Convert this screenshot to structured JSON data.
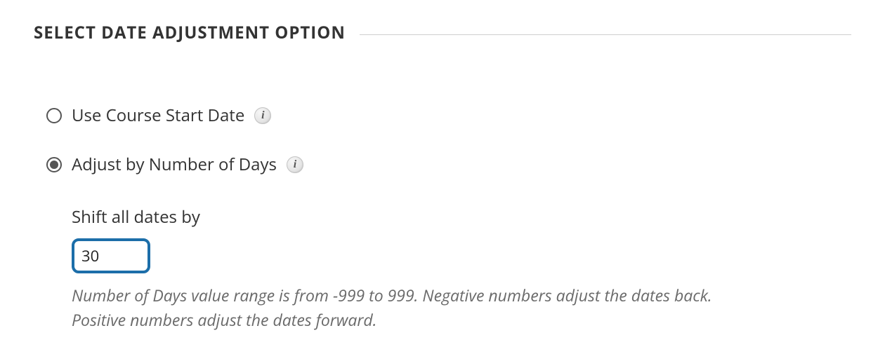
{
  "section": {
    "title": "SELECT DATE ADJUSTMENT OPTION"
  },
  "options": {
    "use_start_date": {
      "label": "Use Course Start Date",
      "selected": false
    },
    "adjust_days": {
      "label": "Adjust by Number of Days",
      "selected": true
    }
  },
  "shift": {
    "label": "Shift all dates by",
    "value": "30",
    "hint": "Number of Days value range is from -999 to 999. Negative numbers adjust the dates back. Positive numbers adjust the dates forward."
  },
  "glyphs": {
    "info": "i"
  }
}
